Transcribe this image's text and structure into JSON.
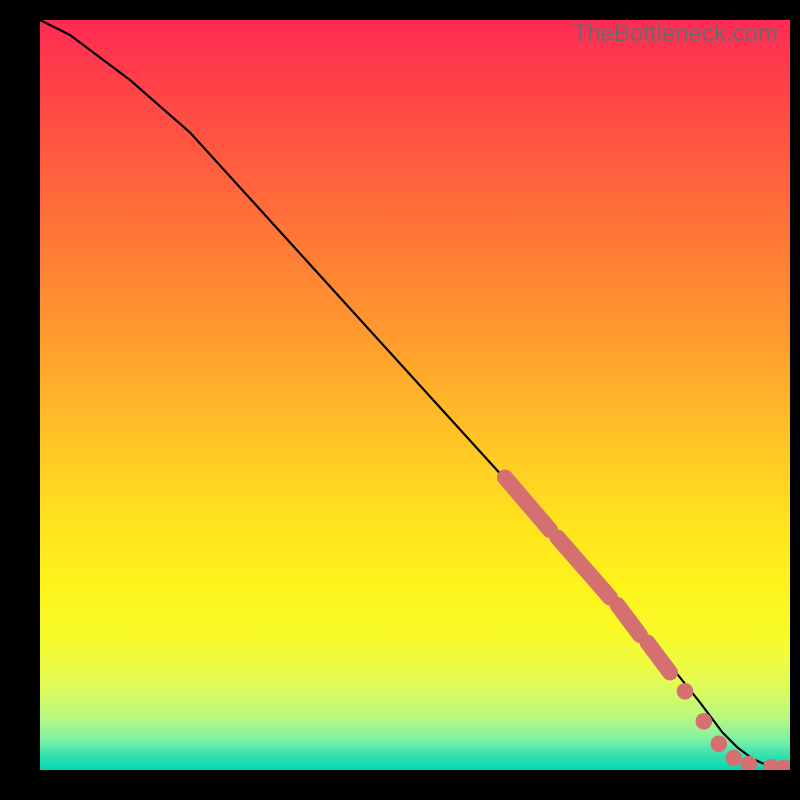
{
  "watermark": "TheBottleneck.com",
  "chart_data": {
    "type": "line",
    "title": "",
    "xlabel": "",
    "ylabel": "",
    "xlim": [
      0,
      100
    ],
    "ylim": [
      0,
      100
    ],
    "gradient_stops": [
      {
        "pos": 0,
        "color": "#ff2a55"
      },
      {
        "pos": 8,
        "color": "#ff4048"
      },
      {
        "pos": 18,
        "color": "#ff5a3f"
      },
      {
        "pos": 30,
        "color": "#ff7a36"
      },
      {
        "pos": 42,
        "color": "#ff9a2e"
      },
      {
        "pos": 55,
        "color": "#ffc127"
      },
      {
        "pos": 66,
        "color": "#ffe020"
      },
      {
        "pos": 75,
        "color": "#fff21b"
      },
      {
        "pos": 82,
        "color": "#f8fb28"
      },
      {
        "pos": 88,
        "color": "#e6fb52"
      },
      {
        "pos": 93,
        "color": "#b9f880"
      },
      {
        "pos": 96,
        "color": "#7ef0a5"
      },
      {
        "pos": 98,
        "color": "#35e2b0"
      },
      {
        "pos": 100,
        "color": "#00d7b1"
      }
    ],
    "series": [
      {
        "name": "bottleneck-curve",
        "x": [
          0,
          4,
          8,
          12,
          20,
          30,
          40,
          50,
          60,
          70,
          78,
          84,
          88,
          91,
          93,
          95,
          97,
          100
        ],
        "y": [
          100,
          98,
          95,
          92,
          85,
          74,
          63,
          52,
          41,
          30,
          21,
          14,
          9,
          5,
          3,
          1.5,
          0.6,
          0.2
        ]
      }
    ],
    "markers": {
      "segments": [
        {
          "x1": 62,
          "y1": 39,
          "x2": 68,
          "y2": 32
        },
        {
          "x1": 69,
          "y1": 31,
          "x2": 76,
          "y2": 23
        },
        {
          "x1": 77,
          "y1": 22,
          "x2": 80,
          "y2": 18
        },
        {
          "x1": 81,
          "y1": 17,
          "x2": 84,
          "y2": 13
        }
      ],
      "dots": [
        {
          "x": 86,
          "y": 10.5
        },
        {
          "x": 88.5,
          "y": 6.5
        },
        {
          "x": 90.5,
          "y": 3.5
        },
        {
          "x": 92.5,
          "y": 1.6
        },
        {
          "x": 94.5,
          "y": 0.8
        },
        {
          "x": 97.5,
          "y": 0.4
        },
        {
          "x": 99.2,
          "y": 0.3
        }
      ],
      "color": "#d47070",
      "radius_percent": 1.1
    }
  }
}
